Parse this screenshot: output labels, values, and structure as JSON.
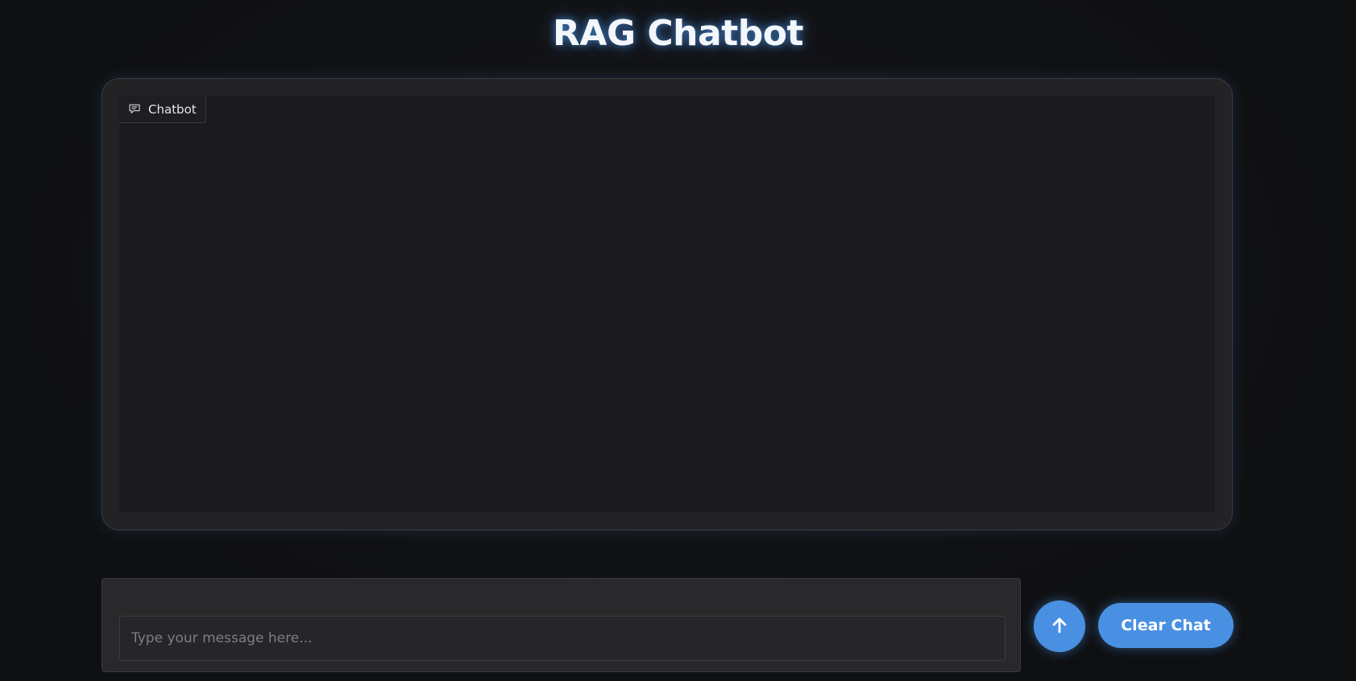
{
  "app": {
    "title": "RAG Chatbot"
  },
  "chatbot": {
    "label": "Chatbot",
    "label_icon": "chat-bubble-icon",
    "messages": []
  },
  "input": {
    "value": "",
    "placeholder": "Type your message here..."
  },
  "actions": {
    "send_icon": "arrow-up-icon",
    "clear_label": "Clear Chat"
  },
  "colors": {
    "accent": "#4a90e2",
    "background": "#0f1012",
    "panel": "#232325",
    "chat_area": "#1b1b1d",
    "text": "#f3f6fb"
  }
}
